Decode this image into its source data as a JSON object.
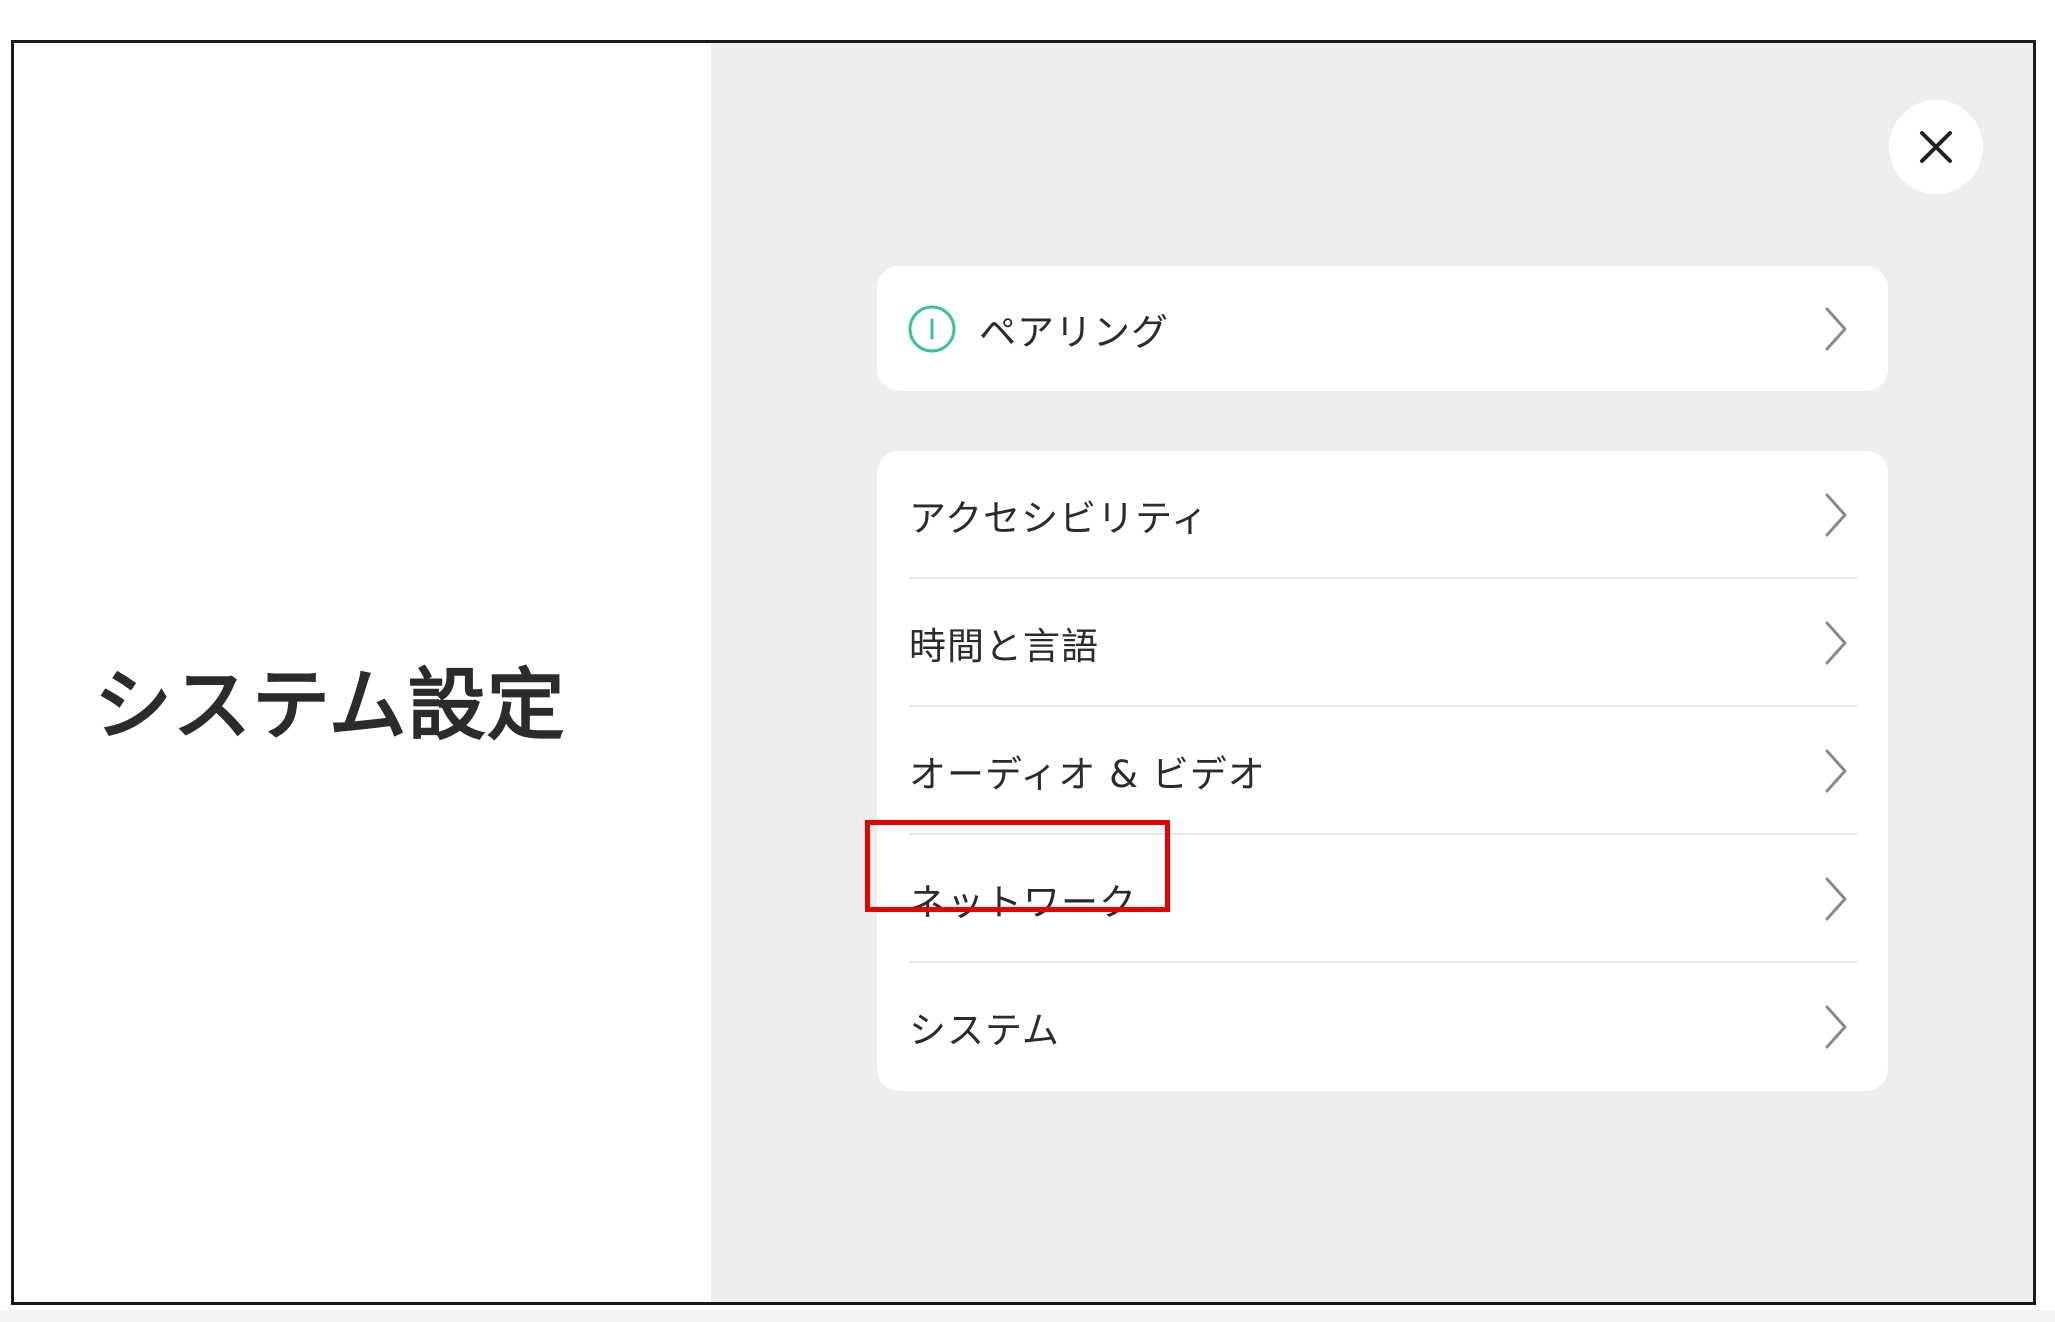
{
  "page": {
    "title": "システム設定"
  },
  "close_button": {
    "icon": "close-icon"
  },
  "pairing": {
    "label": "ペアリング",
    "icon": "pairing-status-icon",
    "icon_color": "#3dbf9c"
  },
  "menu": {
    "items": [
      {
        "label": "アクセシビリティ"
      },
      {
        "label": "時間と言語"
      },
      {
        "label": "オーディオ & ビデオ"
      },
      {
        "label": "ネットワーク"
      },
      {
        "label": "システム"
      }
    ]
  },
  "highlight": {
    "target": "ネットワーク",
    "color": "#e60000"
  },
  "colors": {
    "panel_background": "#eeeeee",
    "card_background": "#ffffff",
    "text": "#2b2b2b",
    "chevron": "#8a8a8a"
  }
}
